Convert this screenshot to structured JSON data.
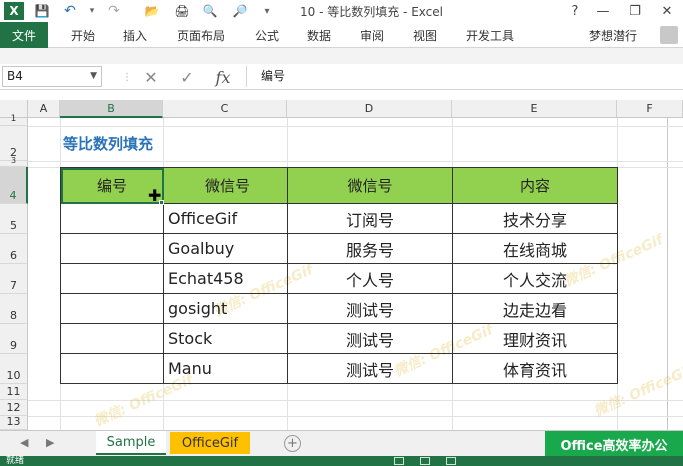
{
  "window": {
    "title": "10 - 等比数列填充 - Excel",
    "help": "?",
    "minimize": "—",
    "restore": "❐",
    "close": "✕"
  },
  "quick_access": {
    "app_icon": "X",
    "save_icon": "💾",
    "undo_icon": "↶",
    "redo_icon": "↷",
    "open_icon": "📂",
    "print_icon": "🖨",
    "preview_icon": "🔍"
  },
  "ribbon": {
    "file_tab": "文件",
    "tabs": [
      "开始",
      "插入",
      "页面布局",
      "公式",
      "数据",
      "审阅",
      "视图",
      "开发工具"
    ],
    "user_name": "梦想潜行"
  },
  "formula_bar": {
    "name_box": "B4",
    "cancel_icon": "✕",
    "enter_icon": "✓",
    "fx_icon": "fx",
    "content": "编号"
  },
  "columns": [
    "A",
    "B",
    "C",
    "D",
    "E",
    "F"
  ],
  "rows": [
    "1",
    "2",
    "3",
    "4",
    "5",
    "6",
    "7",
    "8",
    "9",
    "10",
    "11",
    "12",
    "13"
  ],
  "sheet": {
    "title": "等比数列填充",
    "header": [
      "编号",
      "微信号",
      "微信号",
      "内容"
    ],
    "rows": [
      [
        "",
        "OfficeGif",
        "订阅号",
        "技术分享"
      ],
      [
        "",
        "Goalbuy",
        "服务号",
        "在线商城"
      ],
      [
        "",
        "Echat458",
        "个人号",
        "个人交流"
      ],
      [
        "",
        "gosight",
        "测试号",
        "边走边看"
      ],
      [
        "",
        "Stock",
        "测试号",
        "理财资讯"
      ],
      [
        "",
        "Manu",
        "测试号",
        "体育资讯"
      ]
    ],
    "header_color": "#92d050"
  },
  "watermarks": [
    "微信: OfficeGif",
    "微信: OfficeGif",
    "微信: OfficeGif",
    "微信: OfficeGif",
    "微信: OfficeGif"
  ],
  "sheet_tabs": {
    "prev_icon": "◀",
    "next_icon": "▶",
    "tabs": [
      "Sample",
      "OfficeGif"
    ],
    "add_icon": "+",
    "brand": "Office高效率办公"
  },
  "status_bar": {
    "text": "就绪"
  },
  "colors": {
    "excel_green": "#217346",
    "tab_orange": "#ffc000",
    "brand_green": "#1aa84c",
    "title_blue": "#2a73b8"
  }
}
